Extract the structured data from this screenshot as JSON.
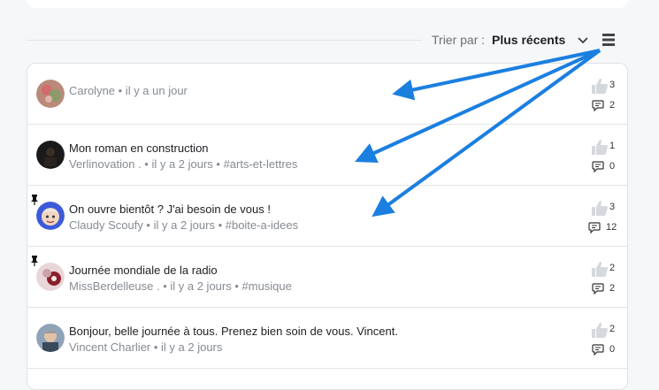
{
  "sort": {
    "label": "Trier par :",
    "value": "Plus récents"
  },
  "posts": [
    {
      "title": "",
      "meta": "Carolyne • il y a un jour",
      "likes": "3",
      "comments": "2",
      "pinned": false
    },
    {
      "title": "Mon roman en construction",
      "meta": "Verlinovation . • il y a 2 jours • #arts-et-lettres",
      "likes": "1",
      "comments": "0",
      "pinned": false
    },
    {
      "title": "On ouvre bientôt ? J'ai besoin de vous !",
      "meta": "Claudy Scoufy • il y a 2 jours • #boite-a-idees",
      "likes": "3",
      "comments": "12",
      "pinned": true
    },
    {
      "title": "Journée mondiale de la radio",
      "meta": "MissBerdelleuse . • il y a 2 jours • #musique",
      "likes": "2",
      "comments": "2",
      "pinned": true
    },
    {
      "title": "Bonjour, belle journée à tous. Prenez bien soin de vous. Vincent.",
      "meta": "Vincent Charlier • il y a 2 jours",
      "likes": "2",
      "comments": "0",
      "pinned": false
    }
  ],
  "colors": {
    "arrow": "#1b7fe0"
  }
}
